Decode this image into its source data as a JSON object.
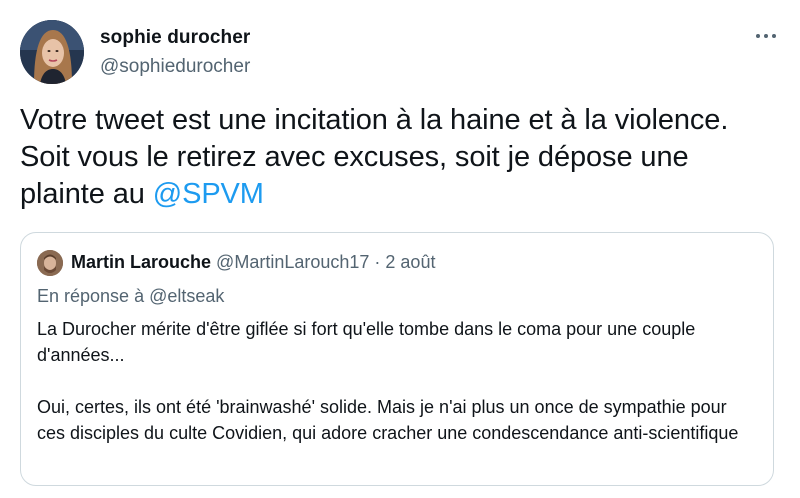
{
  "tweet": {
    "author": {
      "name": "sophie durocher",
      "handle": "@sophiedurocher"
    },
    "more_label": "More options",
    "text_main": "Votre tweet est une incitation à la haine et à la violence. Soit vous le retirez avec excuses, soit je dépose une plainte au ",
    "text_mention": "@SPVM"
  },
  "quote": {
    "author": {
      "name": "Martin Larouche",
      "handle": "@MartinLarouch17",
      "separator": " · ",
      "date": "2 août"
    },
    "reply_prefix": "En réponse à ",
    "reply_mention": "@eltseak",
    "paragraphs": [
      "La Durocher mérite d'être giflée si fort qu'elle tombe dans le coma pour une couple d'années...",
      "Oui, certes, ils ont été 'brainwashé' solide. Mais je n'ai plus un once de sympathie pour ces disciples du culte Covidien, qui adore cracher une condescendance anti-scientifique"
    ]
  },
  "colors": {
    "text": "#0f1419",
    "secondary": "#536471",
    "accent": "#1d9bf0",
    "border": "#cfd9de"
  },
  "icons": {
    "more": "more-horizontal-icon"
  }
}
